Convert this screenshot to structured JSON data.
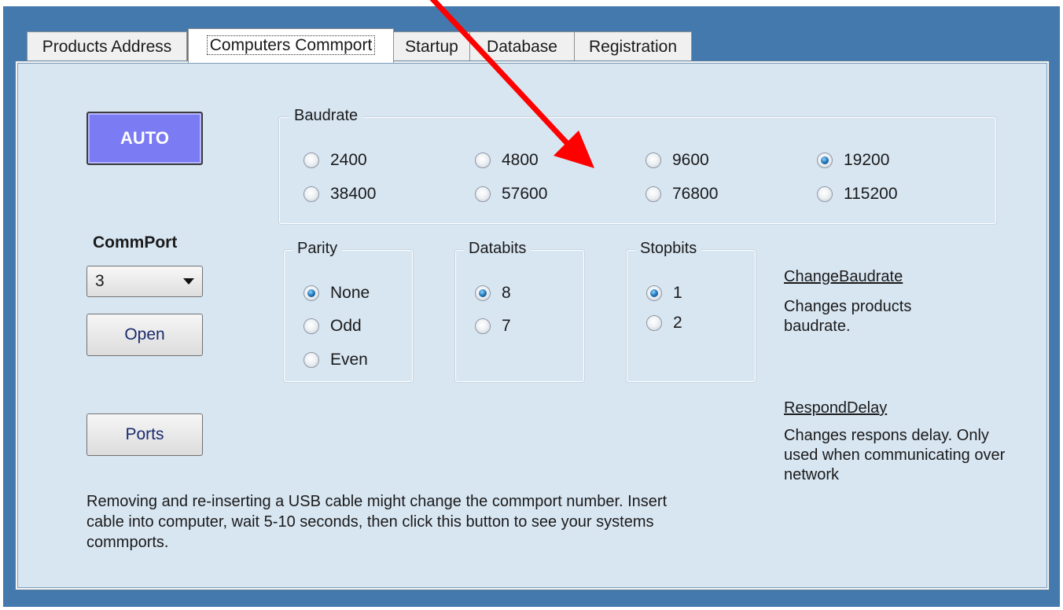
{
  "tabs": [
    {
      "label": "Products Address",
      "active": false
    },
    {
      "label": "Computers Commport",
      "active": true
    },
    {
      "label": "Startup",
      "active": false
    },
    {
      "label": "Database",
      "active": false
    },
    {
      "label": "Registration",
      "active": false
    }
  ],
  "auto_button": "AUTO",
  "baudrate": {
    "label": "Baudrate",
    "options": [
      "2400",
      "4800",
      "9600",
      "19200",
      "38400",
      "57600",
      "76800",
      "115200"
    ],
    "selected": "19200"
  },
  "commport": {
    "label": "CommPort",
    "value": "3",
    "open_button": "Open",
    "ports_button": "Ports"
  },
  "parity": {
    "label": "Parity",
    "options": [
      "None",
      "Odd",
      "Even"
    ],
    "selected": "None"
  },
  "databits": {
    "label": "Databits",
    "options": [
      "8",
      "7"
    ],
    "selected": "8"
  },
  "stopbits": {
    "label": "Stopbits",
    "options": [
      "1",
      "2"
    ],
    "selected": "1"
  },
  "help": {
    "change_baudrate_title": "ChangeBaudrate",
    "change_baudrate_desc": "Changes products baudrate.",
    "respond_delay_title": "RespondDelay",
    "respond_delay_desc": "Changes respons delay. Only used when communicating over network"
  },
  "usb_note": "Removing and re-inserting a USB cable might change the commport number. Insert cable into computer, wait 5-10 seconds, then click this button to see your systems commports.",
  "colors": {
    "window_bg": "#4479ad",
    "panel_bg": "#d8e6f2",
    "auto_button_bg": "#7b7bf3",
    "annotation_arrow": "#ff0000"
  }
}
